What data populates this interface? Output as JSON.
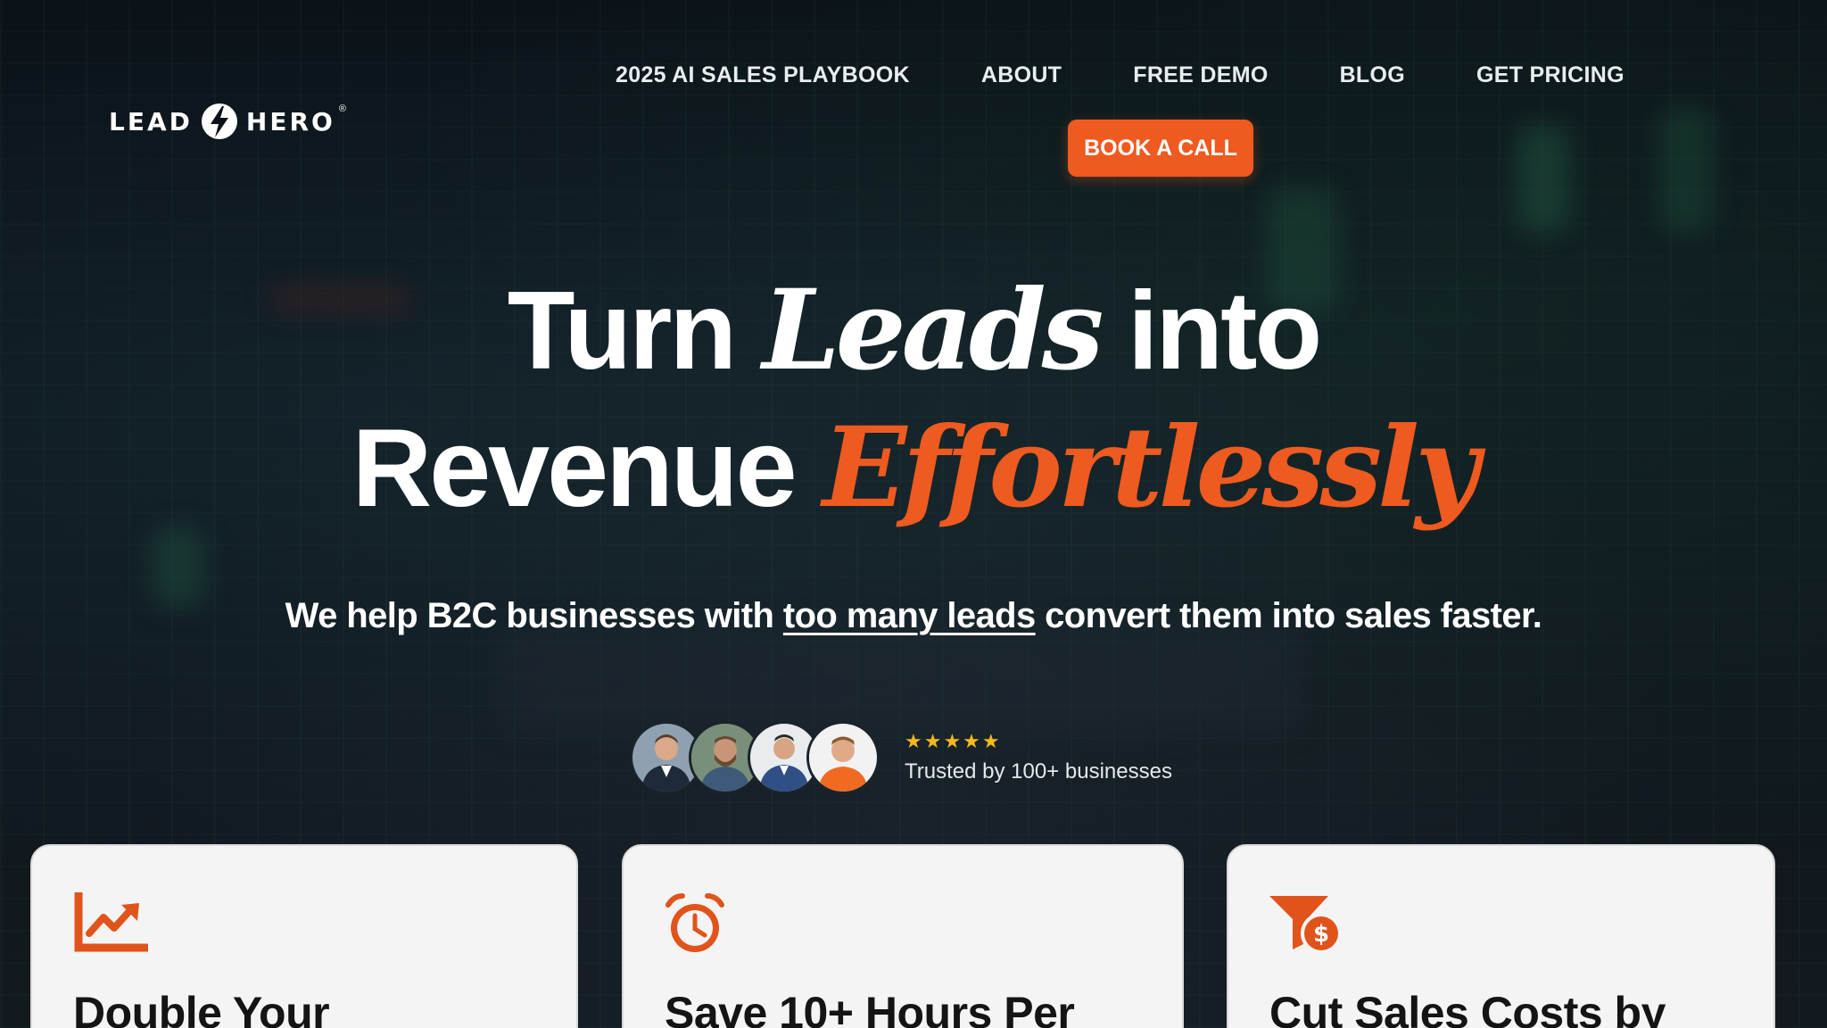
{
  "brand": {
    "logo_left": "LEAD",
    "logo_right": "HERO",
    "logo_reg": "®",
    "accent_color": "#ee5a1f",
    "logo_icon": "lightning-bolt-icon"
  },
  "nav": {
    "items": [
      {
        "label": "2025 AI SALES PLAYBOOK"
      },
      {
        "label": "ABOUT"
      },
      {
        "label": "FREE DEMO"
      },
      {
        "label": "BLOG"
      },
      {
        "label": "GET PRICING"
      }
    ],
    "cta_label": "BOOK A CALL"
  },
  "hero": {
    "line1_pre": "Turn ",
    "line1_em": "Leads",
    "line1_post": " into",
    "line2_pre": "Revenue ",
    "line2_em": "Effortlessly",
    "sub_pre": "We help B2C businesses with ",
    "sub_link": "too many leads",
    "sub_post": " convert them into sales faster."
  },
  "proof": {
    "stars": "★★★★★",
    "rating": 5,
    "text": "Trusted by 100+ businesses",
    "avatar_count": 4
  },
  "cards": [
    {
      "icon": "trending-up-chart-icon",
      "title": "Double Your"
    },
    {
      "icon": "alarm-clock-icon",
      "title": "Save 10+ Hours Per"
    },
    {
      "icon": "funnel-dollar-icon",
      "title": "Cut Sales Costs by"
    }
  ]
}
